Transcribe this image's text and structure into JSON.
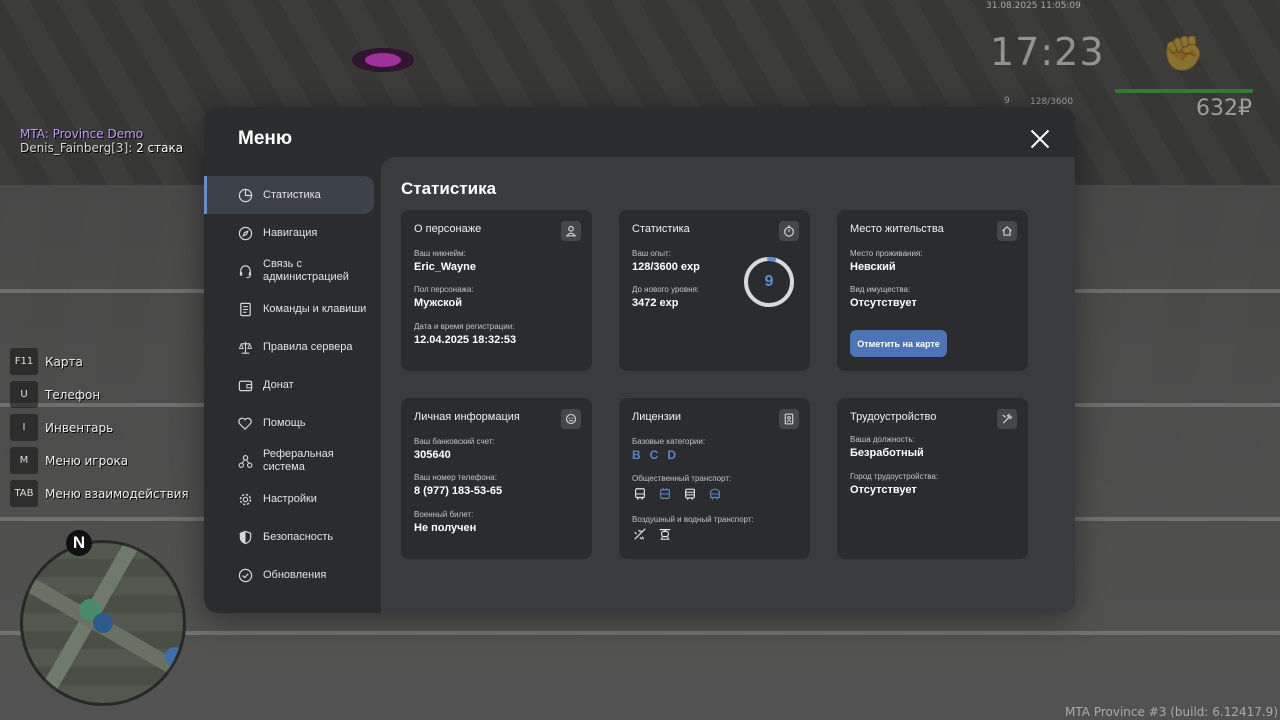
{
  "hud": {
    "datetime": "31.08.2025 11:05:09",
    "time": "17:23",
    "level": "9",
    "exp": "128/3600",
    "money": "632₽"
  },
  "chat": {
    "line1": "MTA: Province Demo",
    "line2_name": "Denis_Fainberg[3]:",
    "line2_text": " 2 стака"
  },
  "keys": [
    {
      "key": "F11",
      "label": "Карта"
    },
    {
      "key": "U",
      "label": "Телефон"
    },
    {
      "key": "I",
      "label": "Инвентарь"
    },
    {
      "key": "M",
      "label": "Меню игрока"
    },
    {
      "key": "TAB",
      "label": "Меню взаимодействия"
    }
  ],
  "minimap": {
    "north": "N"
  },
  "footer": {
    "build": "MTA Province #3 (build: 6.12417.9)"
  },
  "menu": {
    "title": "Меню",
    "nav": [
      {
        "label": "Статистика"
      },
      {
        "label": "Навигация"
      },
      {
        "label": "Связь с администрацией"
      },
      {
        "label": "Команды и клавиши"
      },
      {
        "label": "Правила сервера"
      },
      {
        "label": "Донат"
      },
      {
        "label": "Помощь"
      },
      {
        "label": "Реферальная система"
      },
      {
        "label": "Настройки"
      },
      {
        "label": "Безопасность"
      },
      {
        "label": "Обновления"
      }
    ]
  },
  "content": {
    "title": "Статистика",
    "character": {
      "title": "О персонаже",
      "nick_label": "Ваш никнейм:",
      "nick": "Eric_Wayne",
      "gender_label": "Пол персонажа:",
      "gender": "Мужской",
      "reg_label": "Дата и время регистрации:",
      "reg": "12.04.2025 18:32:53"
    },
    "stats": {
      "title": "Статистика",
      "exp_label": "Ваш опыт:",
      "exp": "128/3600 exp",
      "next_label": "До нового уровня:",
      "next": "3472 exp",
      "level": "9",
      "progress": 0.0356
    },
    "residence": {
      "title": "Место жительства",
      "place_label": "Место проживания:",
      "place": "Невский",
      "type_label": "Вид имущества:",
      "type": "Отсутствует",
      "button": "Отметить на карте"
    },
    "personal": {
      "title": "Личная информация",
      "bank_label": "Ваш банковский счет:",
      "bank": "305640",
      "phone_label": "Ваш номер телефона:",
      "phone": "8 (977) 183-53-65",
      "military_label": "Военный билет:",
      "military": "Не получен"
    },
    "licenses": {
      "title": "Лицензии",
      "base_label": "Базовые категории:",
      "categories": [
        "B",
        "C",
        "D"
      ],
      "public_label": "Общественный транспорт:",
      "air_label": "Воздушный и водный транспорт:"
    },
    "employment": {
      "title": "Трудоустройство",
      "position_label": "Ваша должность:",
      "position": "Безработный",
      "city_label": "Город трудоустройства:",
      "city": "Отсутствует"
    }
  },
  "colors": {
    "accent": "#5b8fd9",
    "button": "#4e73b7",
    "panel": "#2b2c2e",
    "content": "#3a3b3e"
  }
}
